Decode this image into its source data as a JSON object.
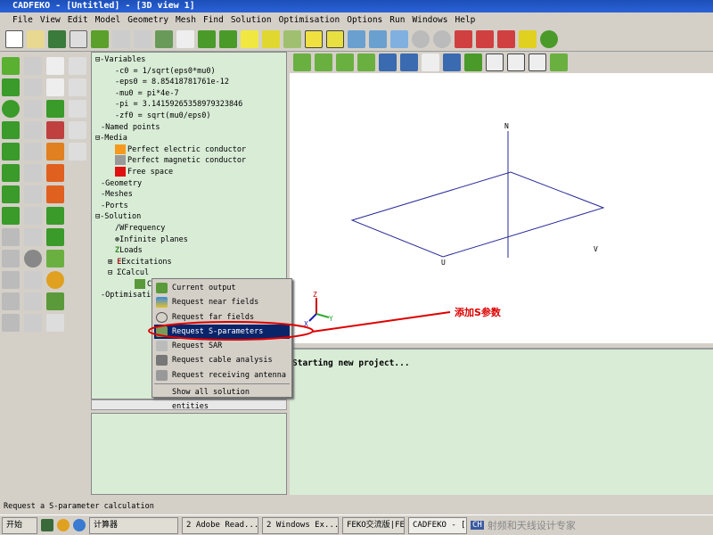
{
  "window": {
    "title": "CADFEKO - [Untitled] - [3D view 1]"
  },
  "menu": [
    "File",
    "View",
    "Edit",
    "Model",
    "Geometry",
    "Mesh",
    "Find",
    "Solution",
    "Optimisation",
    "Options",
    "Run",
    "Windows",
    "Help"
  ],
  "tree": {
    "variables": "Variables",
    "vars": [
      "c0 = 1/sqrt(eps0*mu0)",
      "eps0 = 8.85418781761e-12",
      "mu0 = pi*4e-7",
      "pi = 3.14159265358979323846",
      "zf0 = sqrt(mu0/eps0)"
    ],
    "named_points": "Named points",
    "media": "Media",
    "media_items": [
      {
        "label": "Perfect electric conductor",
        "color": "#f59a1e"
      },
      {
        "label": "Perfect magnetic conductor",
        "color": "#999999"
      },
      {
        "label": "Free space",
        "color": "#e01010"
      }
    ],
    "geometry": "Geometry",
    "meshes": "Meshes",
    "ports": "Ports",
    "solution": "Solution",
    "solution_items": [
      "Frequency",
      "Infinite planes",
      "Loads",
      "Excitations",
      "Calcul"
    ],
    "calc_child": "Cu",
    "optimisation": "Optimisatio"
  },
  "context_menu": {
    "items": [
      "Current output",
      "Request near fields",
      "Request far fields",
      "Request S-parameters",
      "Request SAR",
      "Request cable analysis",
      "Request receiving antenna"
    ],
    "selected": "Request S-parameters",
    "footer": "Show all solution entities"
  },
  "view": {
    "axis_n": "N",
    "axis_u": "U",
    "axis_v": "V",
    "triad_z": "Z",
    "triad_y": "Y",
    "triad_x": "X"
  },
  "annotation": "添加S参数",
  "output": {
    "text": "Starting new project..."
  },
  "status": {
    "text": "Request a S-parameter calculation"
  },
  "taskbar": {
    "start": "开始",
    "items": [
      "计算器",
      "2 Adobe Read...",
      "2 Windows Ex...",
      "FEKO交流版|FE...",
      "CADFEKO - [Un..."
    ],
    "lang": "CH",
    "watermark": "射频和天线设计专家"
  },
  "colors": {
    "highlight": "#0a246a",
    "panel": "#d8ecd6",
    "annotation": "#dd0000"
  }
}
